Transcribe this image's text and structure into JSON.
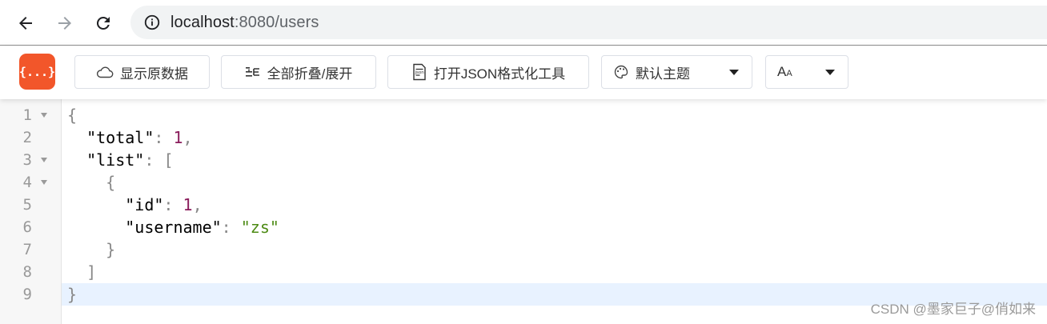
{
  "browser": {
    "url_host": "localhost",
    "url_rest": ":8080/users",
    "icons": {
      "back": "arrow-left-icon",
      "forward": "arrow-right-icon",
      "reload": "reload-icon",
      "info": "info-circle-icon"
    }
  },
  "toolbar": {
    "logo_text": "{...}",
    "raw_label": "显示原数据",
    "fold_label": "全部折叠/展开",
    "json_tool_label": "打开JSON格式化工具",
    "theme_label": "默认主题",
    "font_label_big": "A",
    "font_label_small": "A",
    "accent_color": "#f2562a"
  },
  "editor": {
    "lines": [
      {
        "n": "1",
        "fold": true
      },
      {
        "n": "2",
        "fold": false
      },
      {
        "n": "3",
        "fold": true
      },
      {
        "n": "4",
        "fold": true
      },
      {
        "n": "5",
        "fold": false
      },
      {
        "n": "6",
        "fold": false
      },
      {
        "n": "7",
        "fold": false
      },
      {
        "n": "8",
        "fold": false
      },
      {
        "n": "9",
        "fold": false
      }
    ],
    "tokens": {
      "l1_open": "{",
      "total_key": "\"total\"",
      "total_val": "1",
      "list_key": "\"list\"",
      "list_open": "[",
      "obj_open": "{",
      "id_key": "\"id\"",
      "id_val": "1",
      "username_key": "\"username\"",
      "username_val": "\"zs\"",
      "obj_close": "}",
      "list_close": "]",
      "root_close": "}",
      "colon": ": ",
      "comma": ","
    }
  },
  "watermark": "CSDN @墨家巨子@俏如来"
}
